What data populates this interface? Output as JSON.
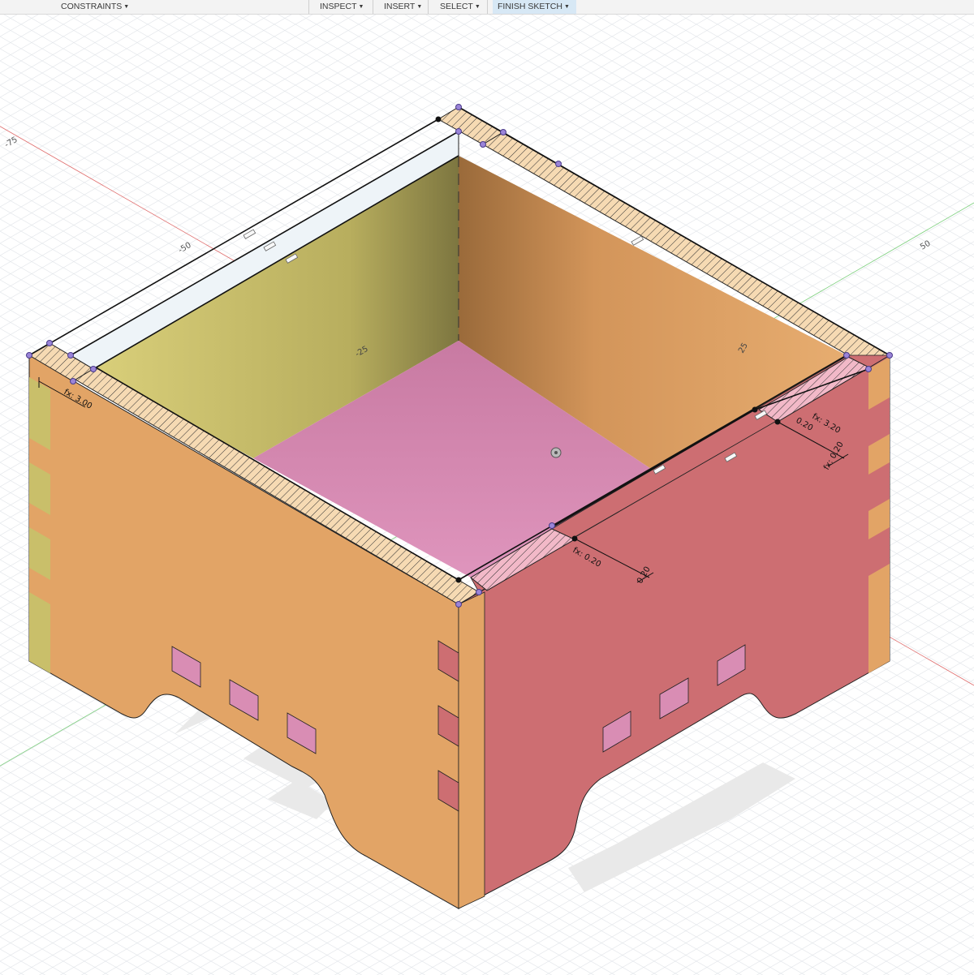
{
  "toolbar": {
    "constraints": "CONSTRAINTS",
    "inspect": "INSPECT",
    "insert": "INSERT",
    "select": "SELECT",
    "finish_sketch": "FINISH SKETCH"
  },
  "axes": {
    "tick_neg75": "-75",
    "tick_neg50": "-50",
    "tick_50": "50",
    "tick_neg25_left": "-25",
    "tick_25_right": "25"
  },
  "dimensions": {
    "left_thickness": "fx: 3.00",
    "right_thickness": "fx: 3.20",
    "right_gap": "0.20",
    "right_offset": "fx: 0.20",
    "bottom_gap": "fx: 0.20",
    "bottom_offset": "0.20"
  },
  "colors": {
    "orange_wall": "#e2a466",
    "pink_wall": "#cd6e72",
    "olive_wall": "#c9c070",
    "floor": "#d98db4",
    "selection_hatch": "#f2b9c8",
    "toolbar_active": "#d7e8f5"
  }
}
